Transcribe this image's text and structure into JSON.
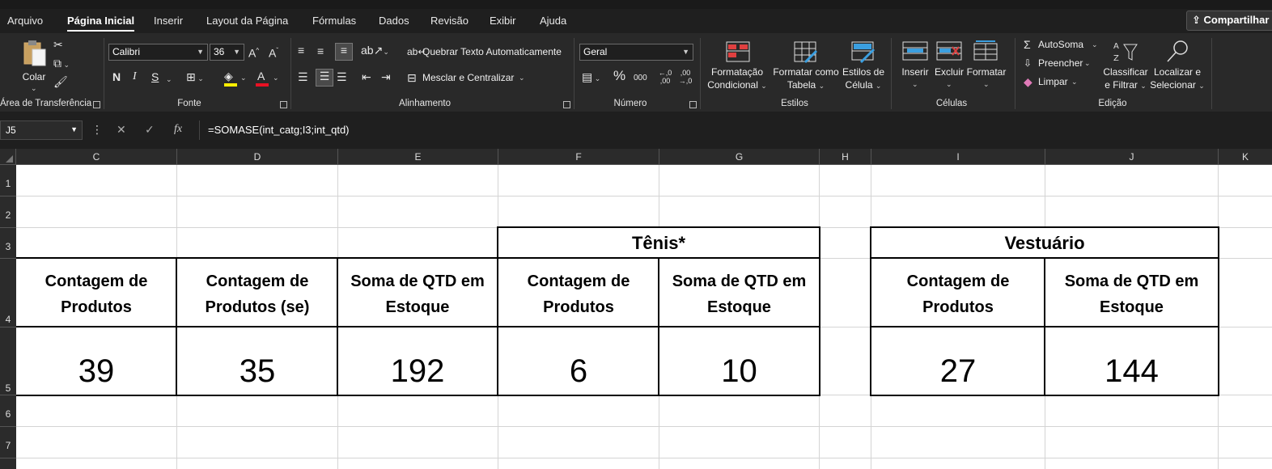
{
  "menu": {
    "tabs": [
      "Arquivo",
      "Página Inicial",
      "Inserir",
      "Layout da Página",
      "Fórmulas",
      "Dados",
      "Revisão",
      "Exibir",
      "Ajuda"
    ],
    "active": "Página Inicial",
    "share_label": "Compartilhar"
  },
  "ribbon": {
    "clipboard": {
      "paste_label": "Colar",
      "group_label": "Área de Transferência"
    },
    "font": {
      "name": "Calibri",
      "size": "36",
      "bold": "N",
      "italic": "I",
      "underline": "S",
      "group_label": "Fonte",
      "font_color": "#e81123",
      "highlight_color": "#ffee00"
    },
    "alignment": {
      "wrap_label": "Quebrar Texto Automaticamente",
      "merge_label": "Mesclar e Centralizar",
      "group_label": "Alinhamento"
    },
    "number": {
      "format": "Geral",
      "percent": "%",
      "thousands": "000",
      "inc_decimal": "←,0 ,00",
      "dec_decimal": ",00 →,0",
      "group_label": "Número"
    },
    "styles": {
      "conditional": [
        "Formatação",
        "Condicional"
      ],
      "as_table": [
        "Formatar como",
        "Tabela"
      ],
      "cell_styles": [
        "Estilos de",
        "Célula"
      ],
      "group_label": "Estilos"
    },
    "cells": {
      "insert": "Inserir",
      "delete": "Excluir",
      "format": "Formatar",
      "group_label": "Células"
    },
    "editing": {
      "autosum": "AutoSoma",
      "fill": "Preencher",
      "clear": "Limpar",
      "sort": [
        "Classificar",
        "e Filtrar"
      ],
      "find": [
        "Localizar e",
        "Selecionar"
      ],
      "group_label": "Edição"
    }
  },
  "formula_bar": {
    "name_box": "J5",
    "cancel": "✕",
    "enter": "✓",
    "fx": "fx",
    "formula": "=SOMASE(int_catg;I3;int_qtd)"
  },
  "grid": {
    "columns": [
      "C",
      "D",
      "E",
      "F",
      "G",
      "H",
      "I",
      "J",
      "K"
    ],
    "rows": [
      "1",
      "2",
      "3",
      "4",
      "5",
      "6",
      "7"
    ]
  },
  "table": {
    "group_tenis": "Tênis*",
    "group_vestuario": "Vestuário",
    "headers": {
      "c": [
        "Contagem de",
        "Produtos"
      ],
      "d": [
        "Contagem de",
        "Produtos (se)"
      ],
      "e": [
        "Soma de QTD em",
        "Estoque"
      ],
      "f": [
        "Contagem de",
        "Produtos"
      ],
      "g": [
        "Soma de QTD em",
        "Estoque"
      ],
      "i": [
        "Contagem de",
        "Produtos"
      ],
      "j": [
        "Soma de QTD em",
        "Estoque"
      ]
    },
    "values": {
      "c": "39",
      "d": "35",
      "e": "192",
      "f": "6",
      "g": "10",
      "i": "27",
      "j": "144"
    }
  }
}
